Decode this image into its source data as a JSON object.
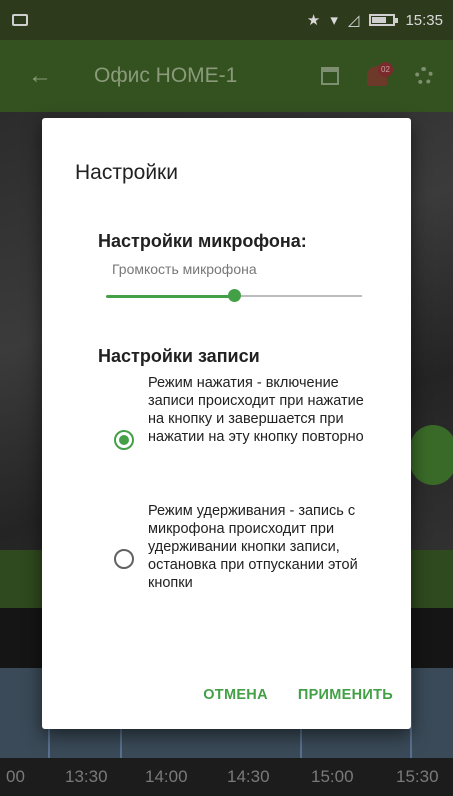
{
  "status_bar": {
    "time": "15:35",
    "star": "★",
    "wifi": "▾",
    "signal": "◿"
  },
  "app_bar": {
    "back": "←",
    "title": "Офис HOME-1",
    "badge": "02"
  },
  "timeline": {
    "labels": [
      "00",
      "13:30",
      "14:00",
      "14:30",
      "15:00",
      "15:30"
    ]
  },
  "dialog": {
    "title": "Настройки",
    "mic_heading": "Настройки микрофона:",
    "volume_label": "Громкость микрофона",
    "volume_value_percent": 50,
    "record_heading": "Настройки записи",
    "options": [
      {
        "text": "Режим нажатия - включение записи происходит при нажатие на кнопку и завершается при нажатии на эту кнопку повторно",
        "checked": true
      },
      {
        "text": "Режим удерживания - запись с микрофона происходит при удерживании кнопки записи, остановка при отпускании этой кнопки",
        "checked": false
      }
    ],
    "cancel_label": "ОТМЕНА",
    "apply_label": "ПРИМЕНИТЬ"
  },
  "colors": {
    "accent": "#43a047",
    "app_bar": "#345220"
  }
}
